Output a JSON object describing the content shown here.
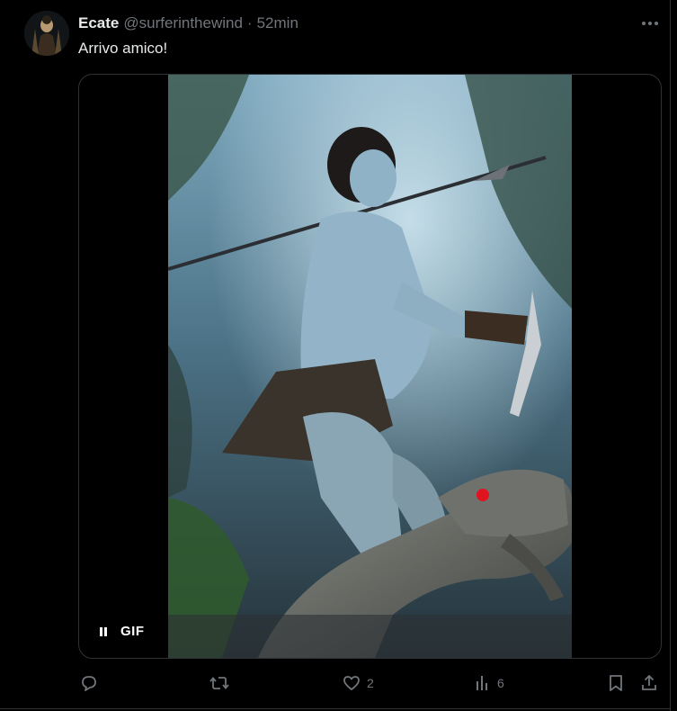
{
  "tweet": {
    "display_name": "Ecate",
    "handle": "@surferinthewind",
    "separator": "·",
    "time": "52min",
    "text": "Arrivo amico!"
  },
  "media": {
    "type": "gif",
    "badge": "GIF",
    "state": "playing",
    "controls_icon": "pause-icon"
  },
  "actions": {
    "reply_count": "",
    "repost_count": "",
    "like_count": "2",
    "views_count": "6"
  },
  "colors": {
    "background": "#000000",
    "text_primary": "#e7e9ea",
    "text_secondary": "#71767b",
    "border": "#2f3336"
  }
}
